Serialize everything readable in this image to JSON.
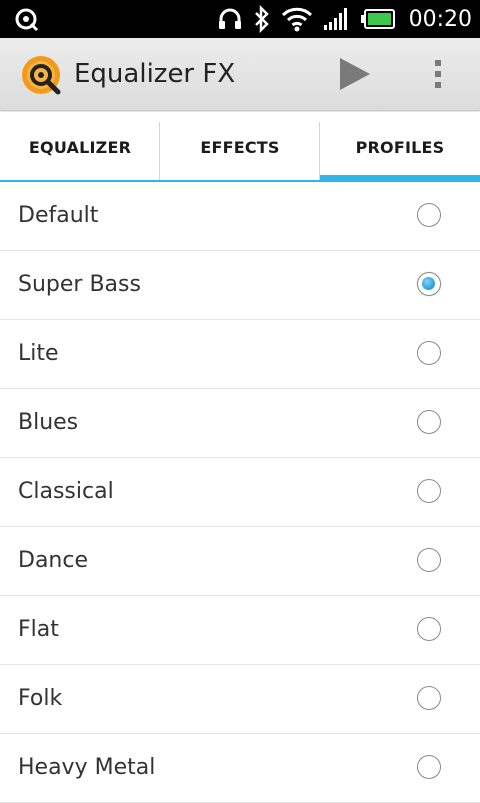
{
  "status_bar": {
    "time": "00:20",
    "icons": [
      "notification-app-icon",
      "headphones-icon",
      "bluetooth-icon",
      "wifi-icon",
      "signal-icon",
      "battery-icon"
    ]
  },
  "action_bar": {
    "title": "Equalizer FX",
    "icons": [
      "app-logo-icon",
      "play-icon",
      "overflow-menu-icon"
    ]
  },
  "tabs": [
    {
      "label": "EQUALIZER",
      "active": false
    },
    {
      "label": "EFFECTS",
      "active": false
    },
    {
      "label": "PROFILES",
      "active": true
    }
  ],
  "profiles": [
    {
      "label": "Default",
      "selected": false
    },
    {
      "label": "Super Bass",
      "selected": true
    },
    {
      "label": "Lite",
      "selected": false
    },
    {
      "label": "Blues",
      "selected": false
    },
    {
      "label": "Classical",
      "selected": false
    },
    {
      "label": "Dance",
      "selected": false
    },
    {
      "label": "Flat",
      "selected": false
    },
    {
      "label": "Folk",
      "selected": false
    },
    {
      "label": "Heavy Metal",
      "selected": false
    }
  ],
  "colors": {
    "accent": "#33b5e5",
    "logo_orange": "#f29a1a",
    "radio_selected": "#1f9fd8"
  }
}
